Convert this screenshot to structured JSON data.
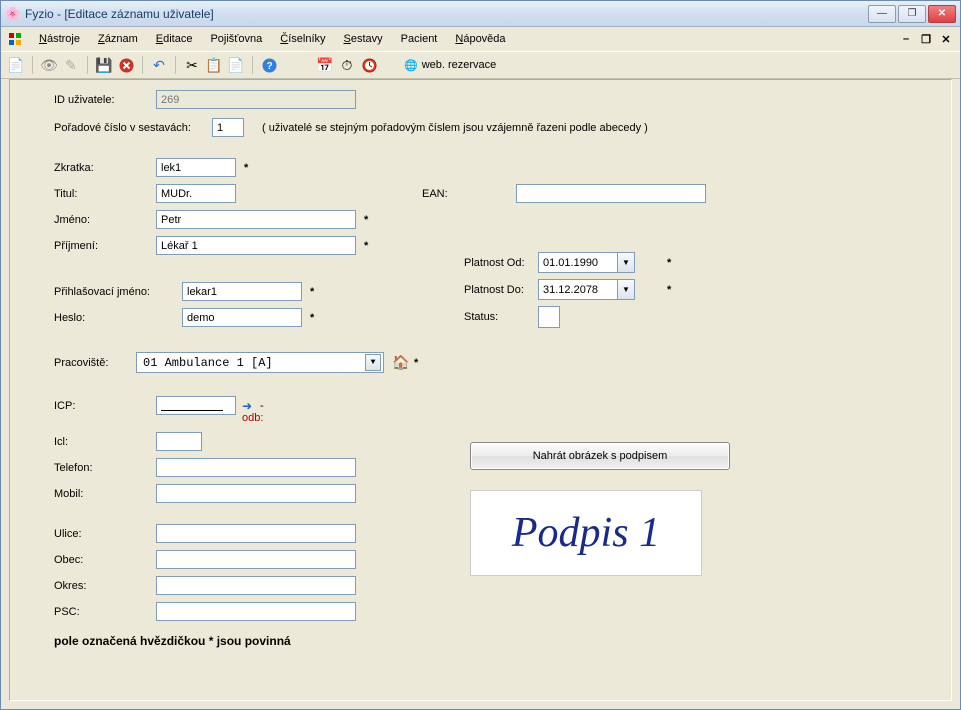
{
  "window": {
    "title": "Fyzio  - [Editace záznamu uživatele]"
  },
  "menu": {
    "nastroje": "Nástroje",
    "zaznam": "Záznam",
    "editace": "Editace",
    "pojistovna": "Pojišťovna",
    "ciselniky": "Číselníky",
    "sestavy": "Sestavy",
    "pacient": "Pacient",
    "napoveda": "Nápověda"
  },
  "toolbar": {
    "web_rezervace": "web. rezervace"
  },
  "form": {
    "id_label": "ID uživatele:",
    "id_value": "269",
    "poradove_label": "Pořadové číslo v sestavách:",
    "poradove_value": "1",
    "poradove_note": "( uživatelé se stejným pořadovým číslem jsou vzájemně řazeni podle abecedy )",
    "zkratka_label": "Zkratka:",
    "zkratka_value": "lek1",
    "titul_label": "Titul:",
    "titul_value": "MUDr.",
    "jmeno_label": "Jméno:",
    "jmeno_value": "Petr",
    "prijmeni_label": "Příjmení:",
    "prijmeni_value": "Lékař 1",
    "login_label": "Přihlašovací jméno:",
    "login_value": "lekar1",
    "heslo_label": "Heslo:",
    "heslo_value": "demo",
    "pracoviste_label": "Pracoviště:",
    "pracoviste_value": "01     Ambulance 1            [A]",
    "icp_label": "ICP:",
    "odb_label": "odb:",
    "icl_label": "Icl:",
    "telefon_label": "Telefon:",
    "mobil_label": "Mobil:",
    "ulice_label": "Ulice:",
    "obec_label": "Obec:",
    "okres_label": "Okres:",
    "psc_label": "PSC:",
    "ean_label": "EAN:",
    "platnost_od_label": "Platnost Od:",
    "platnost_od_value": "01.01.1990",
    "platnost_do_label": "Platnost Do:",
    "platnost_do_value": "31.12.2078",
    "status_label": "Status:",
    "upload_btn": "Nahrát obrázek s podpisem",
    "signature_text": "Podpis 1",
    "required_note": "pole označená hvězdičkou * jsou povinná"
  }
}
